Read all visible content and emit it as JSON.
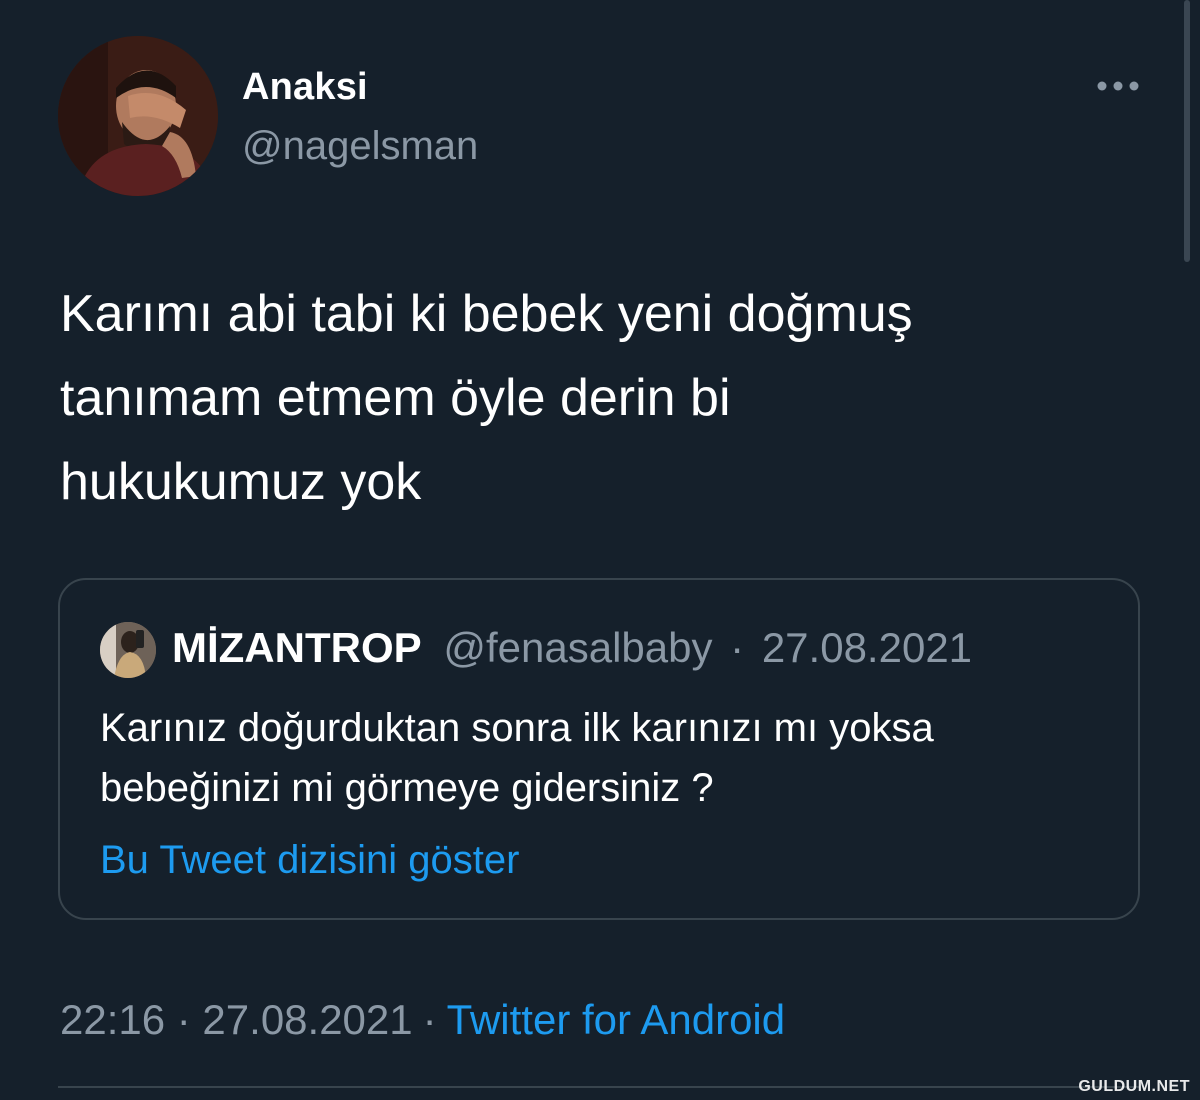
{
  "tweet": {
    "author": {
      "display_name": "Anaksi",
      "username": "@nagelsman"
    },
    "text": "Karımı abi tabi ki bebek yeni doğmuş\ntanımam etmem öyle derin bi\nhukukumuz yok",
    "quoted_tweet": {
      "display_name": "MİZANTROP",
      "username": "@fenasalbaby",
      "separator": "·",
      "date": "27.08.2021",
      "text": "Karınız doğurduktan sonra ilk karınızı mı yoksa\nbebeğinizi mi görmeye gidersiniz ?",
      "thread_link": "Bu Tweet dizisini göster"
    },
    "timestamp": "22:16 · 27.08.2021",
    "separator": "·",
    "source": "Twitter for Android"
  },
  "watermark": "GULDUM.NET",
  "colors": {
    "background": "#15202b",
    "secondary_text": "#8b98a5",
    "link": "#1d9bf0",
    "border": "#38444d"
  },
  "icons": {
    "more": "more-horizontal-icon"
  }
}
